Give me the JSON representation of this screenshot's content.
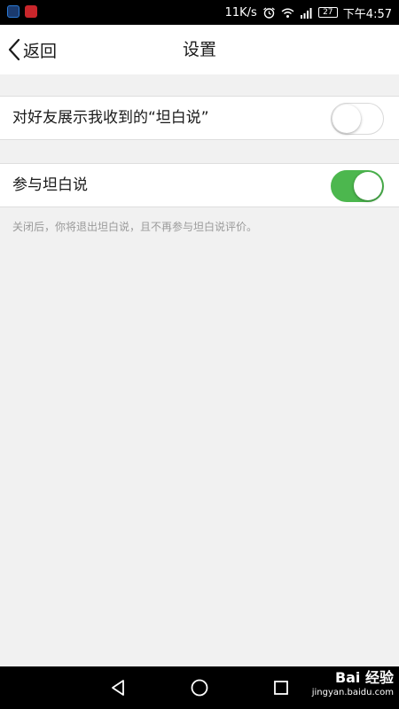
{
  "status_bar": {
    "network_speed": "11K/s",
    "battery_level": "27",
    "time": "下午4:57"
  },
  "header": {
    "back_label": "返回",
    "title": "设置"
  },
  "settings": [
    {
      "label": "对好友展示我收到的“坦白说”",
      "enabled": false
    },
    {
      "label": "参与坦白说",
      "enabled": true
    }
  ],
  "hint": "关闭后，你将退出坦白说，且不再参与坦白说评价。",
  "watermark": {
    "main": "Bai 经验",
    "sub": "jingyan.baidu.com"
  },
  "colors": {
    "toggle_on": "#4cb74e",
    "background": "#f1f1f1"
  },
  "icons": {
    "status_left": [
      "security-app-icon",
      "notification-app-icon"
    ],
    "status_right": [
      "alarm-icon",
      "wifi-icon",
      "signal-icon",
      "battery-icon"
    ],
    "nav": [
      "back-triangle-icon",
      "home-circle-icon",
      "recents-square-icon"
    ]
  }
}
